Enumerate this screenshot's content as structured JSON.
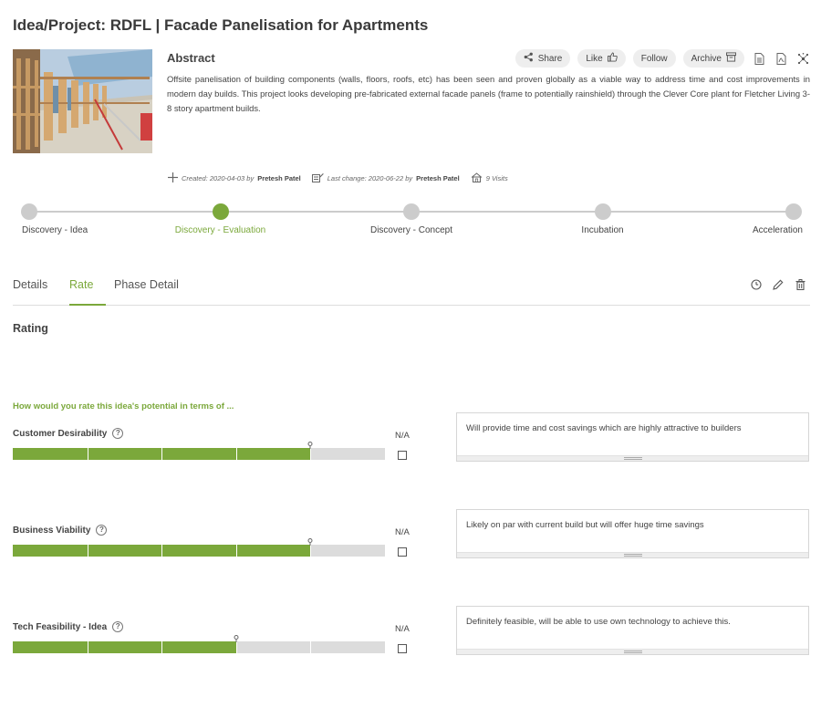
{
  "page": {
    "title": "Idea/Project: RDFL | Facade Panelisation for Apartments"
  },
  "abstract": {
    "heading": "Abstract",
    "text": "Offsite panelisation of building components (walls, floors, roofs, etc) has been seen and proven globally as a viable way to address time and cost improvements in modern day builds. This project looks developing pre-fabricated external facade panels (frame to potentially rainshield) through the Clever Core plant for Fletcher Living 3-8 story apartment builds."
  },
  "actions": {
    "share": "Share",
    "like": "Like",
    "follow": "Follow",
    "archive": "Archive"
  },
  "meta": {
    "created_label": "Created: 2020-04-03 by",
    "created_by": "Pretesh Patel",
    "changed_label": "Last change: 2020-06-22 by",
    "changed_by": "Pretesh Patel",
    "visits": "9 Visits"
  },
  "stepper": {
    "active_index": 1,
    "steps": [
      "Discovery - Idea",
      "Discovery - Evaluation",
      "Discovery - Concept",
      "Incubation",
      "Acceleration"
    ]
  },
  "tabs": {
    "active_index": 1,
    "items": [
      "Details",
      "Rate",
      "Phase Detail"
    ]
  },
  "rating": {
    "title": "Rating",
    "question": "How would you rate this idea's potential in terms of ...",
    "na_label": "N/A",
    "criteria": [
      {
        "label": "Customer Desirability",
        "value": 4,
        "max": 5,
        "comment": "Will provide time and cost savings which are highly attractive to builders"
      },
      {
        "label": "Business Viability",
        "value": 4,
        "max": 5,
        "comment": "Likely on par with current build but will offer huge time savings"
      },
      {
        "label": "Tech Feasibility - Idea",
        "value": 3,
        "max": 5,
        "comment": "Definitely feasible, will be able to use own technology to achieve this."
      }
    ]
  },
  "colors": {
    "accent": "#7ba83b",
    "inactive": "#cccccc",
    "track": "#dcdcdc"
  },
  "icons": {
    "share": "share-icon",
    "like": "thumbs-up-icon",
    "archive": "archive-box-icon",
    "document": "document-icon",
    "pdf": "pdf-icon",
    "network": "network-icon",
    "created": "plus-icon",
    "changed": "edit-document-icon",
    "visits": "house-icon",
    "history": "clock-icon",
    "edit": "pencil-icon",
    "delete": "trash-icon",
    "help": "question-circle-icon"
  }
}
